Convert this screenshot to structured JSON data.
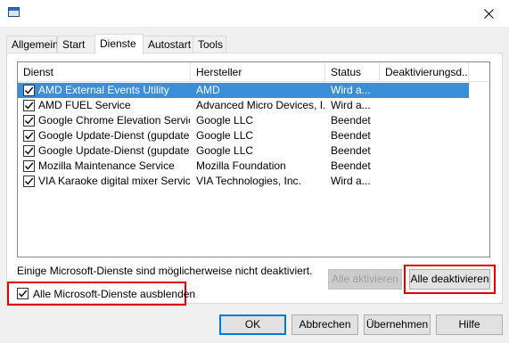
{
  "window": {
    "close_icon": "close-icon",
    "app_icon": "system-config-icon"
  },
  "tabs": [
    {
      "label": "Allgemein"
    },
    {
      "label": "Start"
    },
    {
      "label": "Dienste"
    },
    {
      "label": "Autostart"
    },
    {
      "label": "Tools"
    }
  ],
  "active_tab": "Dienste",
  "columns": [
    "Dienst",
    "Hersteller",
    "Status",
    "Deaktivierungsd..."
  ],
  "services": [
    {
      "name": "AMD External Events Utility",
      "vendor": "AMD",
      "status": "Wird a...",
      "checked": true,
      "selected": true
    },
    {
      "name": "AMD FUEL Service",
      "vendor": "Advanced Micro Devices, I...",
      "status": "Wird a...",
      "checked": true,
      "selected": false
    },
    {
      "name": "Google Chrome Elevation Service",
      "vendor": "Google LLC",
      "status": "Beendet",
      "checked": true,
      "selected": false
    },
    {
      "name": "Google Update-Dienst (gupdate)",
      "vendor": "Google LLC",
      "status": "Beendet",
      "checked": true,
      "selected": false
    },
    {
      "name": "Google Update-Dienst (gupdatem)",
      "vendor": "Google LLC",
      "status": "Beendet",
      "checked": true,
      "selected": false
    },
    {
      "name": "Mozilla Maintenance Service",
      "vendor": "Mozilla Foundation",
      "status": "Beendet",
      "checked": true,
      "selected": false
    },
    {
      "name": "VIA Karaoke digital mixer Service",
      "vendor": "VIA Technologies, Inc.",
      "status": "Wird a...",
      "checked": true,
      "selected": false
    }
  ],
  "note": "Einige Microsoft-Dienste sind möglicherweise nicht deaktiviert.",
  "hide_ms_label": "Alle Microsoft-Dienste ausblenden",
  "hide_ms_checked": true,
  "buttons": {
    "enable_all": "Alle aktivieren",
    "disable_all": "Alle deaktivieren",
    "ok": "OK",
    "cancel": "Abbrechen",
    "apply": "Übernehmen",
    "help": "Hilfe"
  },
  "colors": {
    "selection": "#3b8fd8",
    "highlight_frame": "#e00000",
    "default_button_border": "#0078d7"
  }
}
